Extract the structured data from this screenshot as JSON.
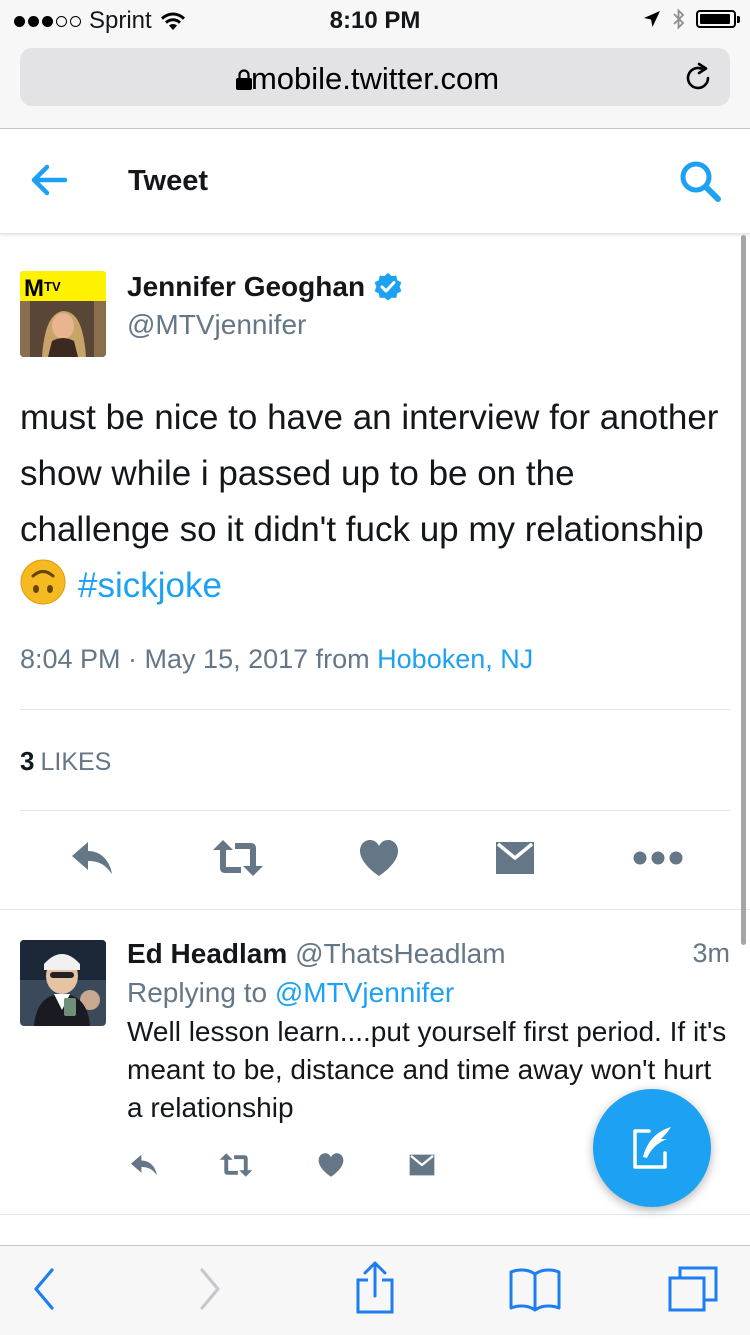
{
  "status_bar": {
    "carrier": "Sprint",
    "time": "8:10 PM"
  },
  "browser": {
    "url": "mobile.twitter.com"
  },
  "header": {
    "title": "Tweet"
  },
  "tweet": {
    "author_name": "Jennifer Geoghan",
    "author_handle": "@MTVjennifer",
    "text_main": "must be nice to have an interview for another show while i passed up to be on the challenge so it didn't fuck up my relationship",
    "emoji": "upside-down-face",
    "hashtag": "#sickjoke",
    "timestamp": "8:04 PM · May 15, 2017 from",
    "location": "Hoboken, NJ",
    "likes_count": "3",
    "likes_label": "LIKES"
  },
  "reply": {
    "author_name": "Ed Headlam",
    "author_handle": "@ThatsHeadlam",
    "time": "3m",
    "replying_prefix": "Replying to",
    "replying_to": "@MTVjennifer",
    "text": "Well lesson learn....put yourself first period. If it's meant to be, distance and time away won't hurt a relationship"
  },
  "colors": {
    "accent": "#1da1f2",
    "secondary_text": "#657786",
    "primary_text": "#14171a",
    "action_gray": "#657786",
    "mtv_yellow": "#fff200"
  },
  "icons": [
    "back-arrow-icon",
    "search-icon",
    "verified-icon",
    "reply-icon",
    "retweet-icon",
    "like-icon",
    "dm-icon",
    "more-icon",
    "compose-icon",
    "lock-icon",
    "reload-icon",
    "wifi-icon",
    "location-icon",
    "bluetooth-icon",
    "battery-icon",
    "safari-back-icon",
    "safari-forward-icon",
    "share-icon",
    "bookmarks-icon",
    "tabs-icon"
  ]
}
